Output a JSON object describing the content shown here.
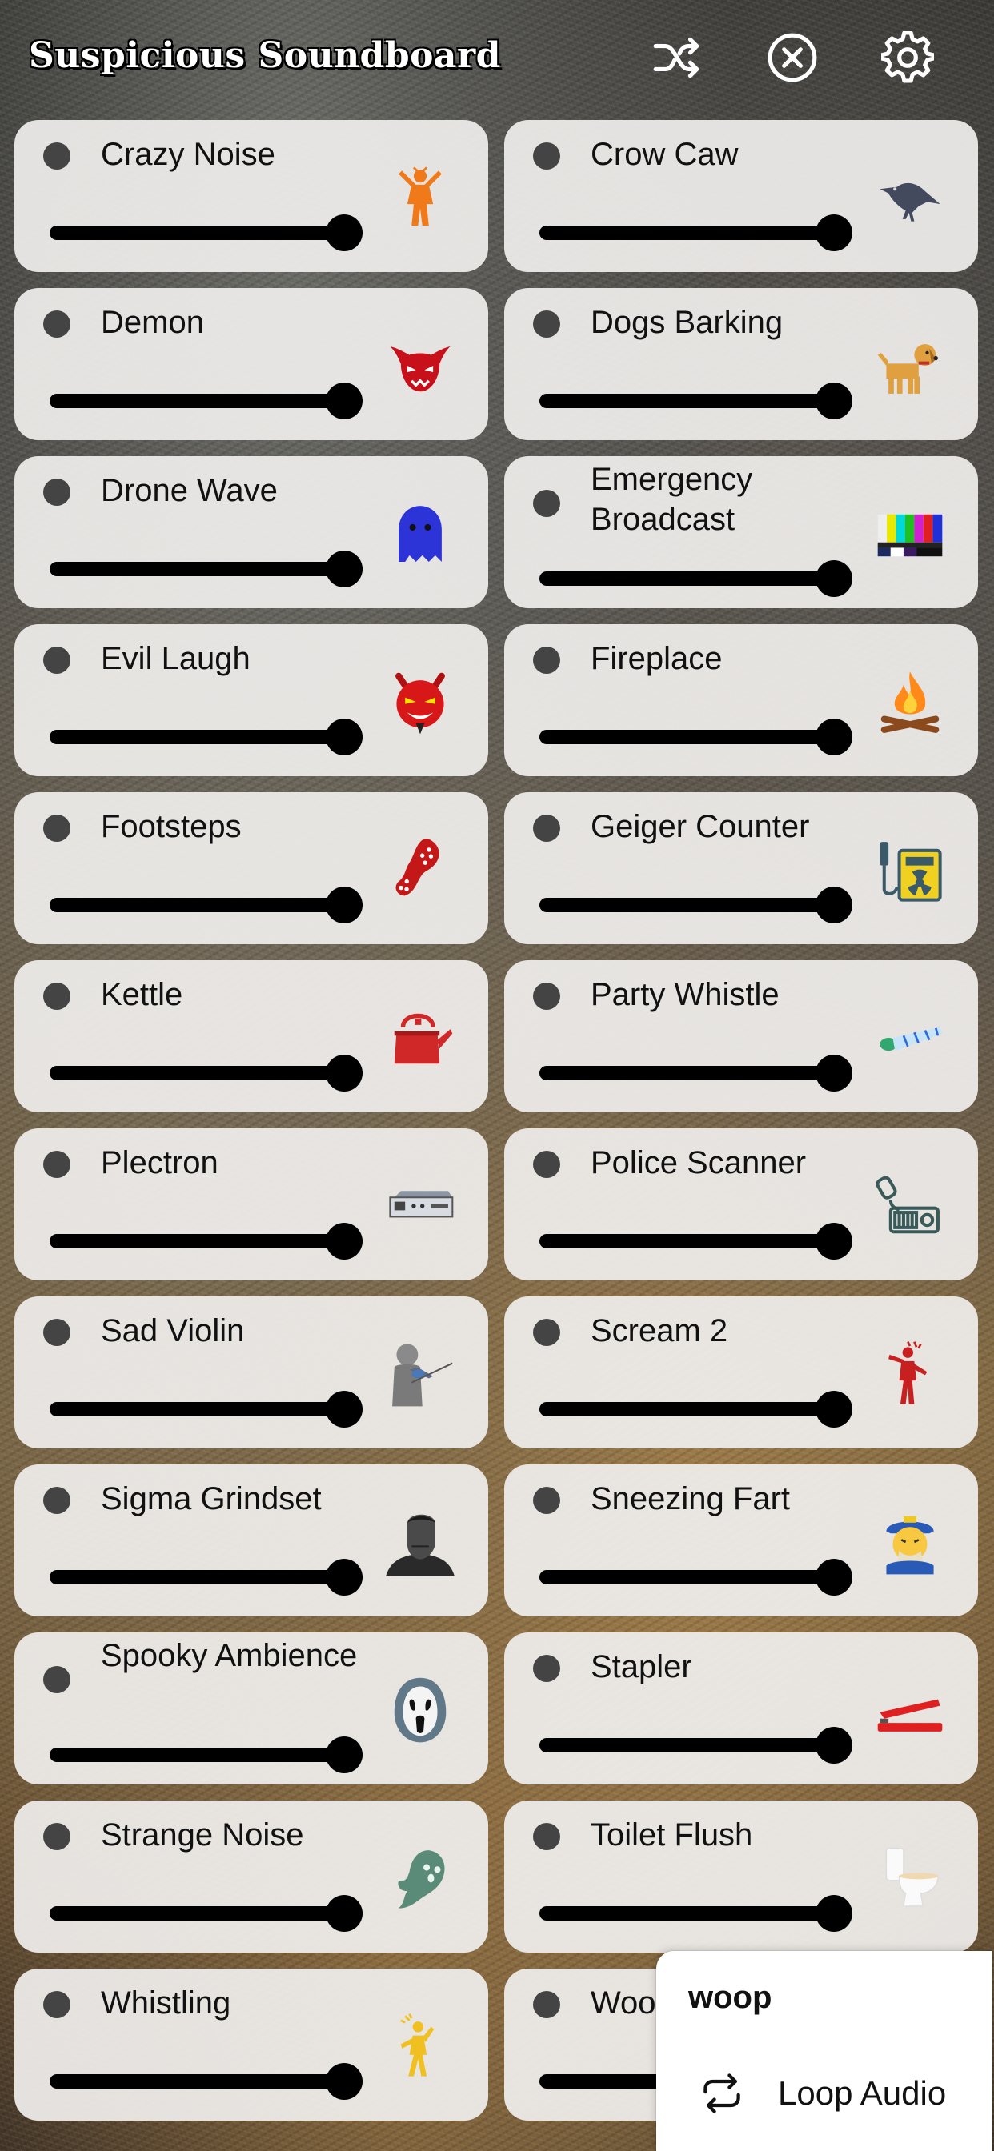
{
  "app": {
    "title": "Suspicious Soundboard"
  },
  "toolbar": {
    "shuffle_icon": "shuffle-icon",
    "close_icon": "close-circle-icon",
    "settings_icon": "gear-icon"
  },
  "sounds": [
    {
      "label": "Crazy Noise",
      "icon": "crazy-person-icon",
      "volume": 1.0
    },
    {
      "label": "Crow Caw",
      "icon": "crow-icon",
      "volume": 1.0
    },
    {
      "label": "Demon",
      "icon": "demon-icon",
      "volume": 1.0
    },
    {
      "label": "Dogs Barking",
      "icon": "dog-icon",
      "volume": 1.0
    },
    {
      "label": "Drone Wave",
      "icon": "ghost-icon",
      "volume": 1.0
    },
    {
      "label": "Emergency Broadcast",
      "icon": "tv-test-pattern-icon",
      "volume": 1.0
    },
    {
      "label": "Evil Laugh",
      "icon": "devil-icon",
      "volume": 1.0
    },
    {
      "label": "Fireplace",
      "icon": "campfire-icon",
      "volume": 1.0
    },
    {
      "label": "Footsteps",
      "icon": "shoe-print-icon",
      "volume": 1.0
    },
    {
      "label": "Geiger Counter",
      "icon": "radiation-meter-icon",
      "volume": 1.0
    },
    {
      "label": "Kettle",
      "icon": "kettle-icon",
      "volume": 1.0
    },
    {
      "label": "Party Whistle",
      "icon": "party-blower-icon",
      "volume": 1.0
    },
    {
      "label": "Plectron",
      "icon": "radio-receiver-icon",
      "volume": 1.0
    },
    {
      "label": "Police Scanner",
      "icon": "police-radio-icon",
      "volume": 1.0
    },
    {
      "label": "Sad Violin",
      "icon": "violinist-icon",
      "volume": 1.0
    },
    {
      "label": "Scream 2",
      "icon": "screaming-person-icon",
      "volume": 1.0
    },
    {
      "label": "Sigma Grindset",
      "icon": "sigma-face-icon",
      "volume": 1.0
    },
    {
      "label": "Sneezing Fart",
      "icon": "sneezing-face-icon",
      "volume": 1.0
    },
    {
      "label": "Spooky Ambience",
      "icon": "ghostface-mask-icon",
      "volume": 1.0
    },
    {
      "label": "Stapler",
      "icon": "stapler-icon",
      "volume": 1.0
    },
    {
      "label": "Strange Noise",
      "icon": "wispy-ghost-icon",
      "volume": 1.0
    },
    {
      "label": "Toilet Flush",
      "icon": "toilet-icon",
      "volume": 1.0
    },
    {
      "label": "Whistling",
      "icon": "whistling-person-icon",
      "volume": 1.0
    },
    {
      "label": "Woo",
      "icon": "",
      "volume": 1.0
    }
  ],
  "popup": {
    "title": "woop",
    "loop_label": "Loop Audio",
    "loop_icon": "loop-icon"
  },
  "colors": {
    "card_bg": "#eeecea",
    "slider": "#000000",
    "dot": "#444444",
    "title_text": "#ffffff"
  }
}
